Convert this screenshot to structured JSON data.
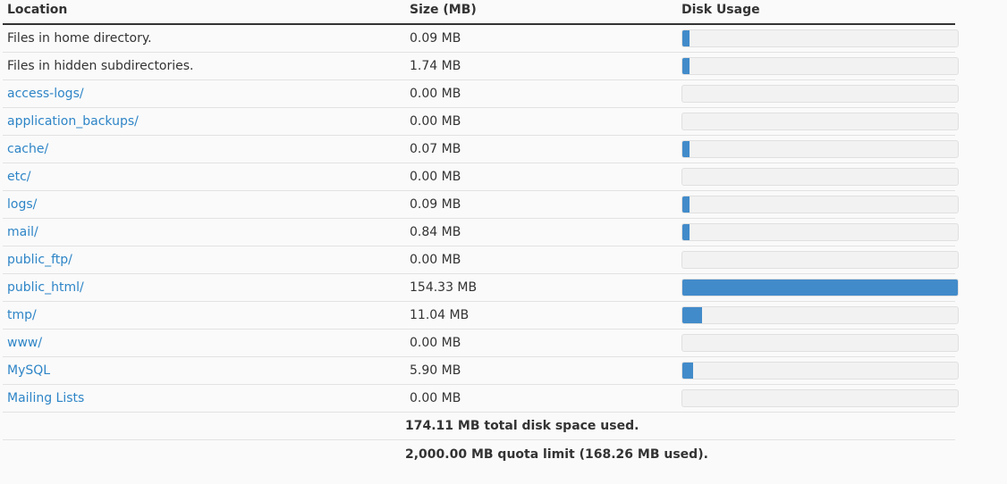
{
  "table": {
    "headers": {
      "location": "Location",
      "size": "Size (MB)",
      "usage": "Disk Usage"
    },
    "rows": [
      {
        "location": "Files in home directory.",
        "size": "0.09 MB",
        "usage_fraction": 0.0006,
        "is_link": false
      },
      {
        "location": "Files in hidden subdirectories.",
        "size": "1.74 MB",
        "usage_fraction": 0.0113,
        "is_link": false
      },
      {
        "location": "access-logs/",
        "size": "0.00 MB",
        "usage_fraction": 0.0,
        "is_link": true
      },
      {
        "location": "application_backups/",
        "size": "0.00 MB",
        "usage_fraction": 0.0,
        "is_link": true
      },
      {
        "location": "cache/",
        "size": "0.07 MB",
        "usage_fraction": 0.0005,
        "is_link": true
      },
      {
        "location": "etc/",
        "size": "0.00 MB",
        "usage_fraction": 0.0,
        "is_link": true
      },
      {
        "location": "logs/",
        "size": "0.09 MB",
        "usage_fraction": 0.0006,
        "is_link": true
      },
      {
        "location": "mail/",
        "size": "0.84 MB",
        "usage_fraction": 0.0054,
        "is_link": true
      },
      {
        "location": "public_ftp/",
        "size": "0.00 MB",
        "usage_fraction": 0.0,
        "is_link": true
      },
      {
        "location": "public_html/",
        "size": "154.33 MB",
        "usage_fraction": 1.0,
        "is_link": true
      },
      {
        "location": "tmp/",
        "size": "11.04 MB",
        "usage_fraction": 0.0715,
        "is_link": true
      },
      {
        "location": "www/",
        "size": "0.00 MB",
        "usage_fraction": 0.0,
        "is_link": true
      },
      {
        "location": "MySQL",
        "size": "5.90 MB",
        "usage_fraction": 0.0382,
        "is_link": true
      },
      {
        "location": "Mailing Lists",
        "size": "0.00 MB",
        "usage_fraction": 0.0,
        "is_link": true
      }
    ],
    "total": "174.11 MB total disk space used.",
    "quota": "2,000.00 MB quota limit (168.26 MB used)."
  },
  "colors": {
    "link": "#2e85c7",
    "bar_fill": "#428bca",
    "bar_track": "#f2f2f2"
  }
}
